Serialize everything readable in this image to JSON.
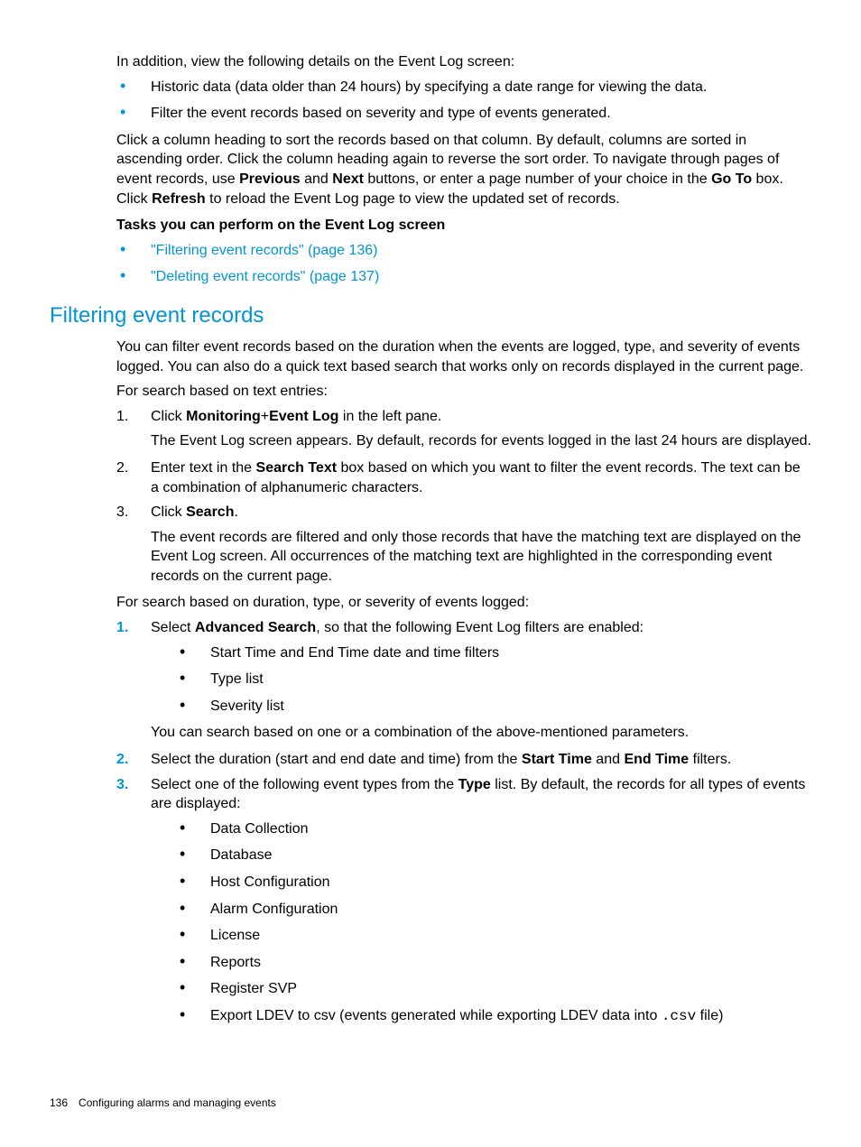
{
  "intro": {
    "line1": "In addition, view the following details on the Event Log screen:",
    "bul1": "Historic data (data older than 24 hours) by specifying a date range for viewing the data.",
    "bul2": "Filter the event records based on severity and type of events generated.",
    "para2_a": "Click a column heading to sort the records based on that column. By default, columns are sorted in ascending order. Click the column heading again to reverse the sort order. To navigate through pages of event records, use ",
    "prev": "Previous",
    "and": " and ",
    "next": "Next",
    "para2_b": " buttons, or enter a page number of your choice in the ",
    "goto": "Go To",
    "para2_c": " box. Click ",
    "refresh": "Refresh",
    "para2_d": " to reload the Event Log page to view the updated set of records.",
    "tasks_head": "Tasks you can perform on the Event Log screen",
    "task1": "\"Filtering event records\" (page 136)",
    "task2": "\"Deleting event records\" (page 137)"
  },
  "section": {
    "title": "Filtering event records",
    "p1": "You can filter event records based on the duration when the events are logged, type, and severity of events logged. You can also do a quick text based search that works only on records displayed in the current page.",
    "p2": "For search based on text entries:",
    "step1_a": "Click ",
    "step1_b1": "Monitoring",
    "step1_plus": "+",
    "step1_b2": "Event Log",
    "step1_c": " in the left pane.",
    "step1_follow": "The Event Log screen appears. By default, records for events logged in the last 24 hours are displayed.",
    "step2_a": "Enter text in the ",
    "step2_b": "Search Text",
    "step2_c": " box based on which you want to filter the event records. The text can be a combination of alphanumeric characters.",
    "step3_a": "Click ",
    "step3_b": "Search",
    "step3_c": ".",
    "step3_follow": "The event records are filtered and only those records that have the matching text are displayed on the Event Log screen. All occurrences of the matching text are highlighted in the corresponding event records on the current page.",
    "p3": "For search based on duration, type, or severity of events logged:",
    "bstep1_a": "Select ",
    "bstep1_b": "Advanced Search",
    "bstep1_c": ", so that the following Event Log filters are enabled:",
    "bstep1_i1": "Start Time and End Time date and time filters",
    "bstep1_i2": "Type list",
    "bstep1_i3": "Severity list",
    "bstep1_follow": "You can search based on one or a combination of the above-mentioned parameters.",
    "bstep2_a": "Select the duration (start and end date and time) from the ",
    "bstep2_b": "Start Time",
    "bstep2_c": " and ",
    "bstep2_d": "End Time",
    "bstep2_e": " filters.",
    "bstep3_a": "Select one of the following event types from the ",
    "bstep3_b": "Type",
    "bstep3_c": " list. By default, the records for all types of events are displayed:",
    "et1": "Data Collection",
    "et2": "Database",
    "et3": "Host Configuration",
    "et4": "Alarm Configuration",
    "et5": "License",
    "et6": "Reports",
    "et7": "Register SVP",
    "et8_a": "Export LDEV to csv (events generated while exporting LDEV data into ",
    "et8_b": ".csv",
    "et8_c": " file)"
  },
  "footer": {
    "page": "136",
    "title": "Configuring alarms and managing events"
  }
}
